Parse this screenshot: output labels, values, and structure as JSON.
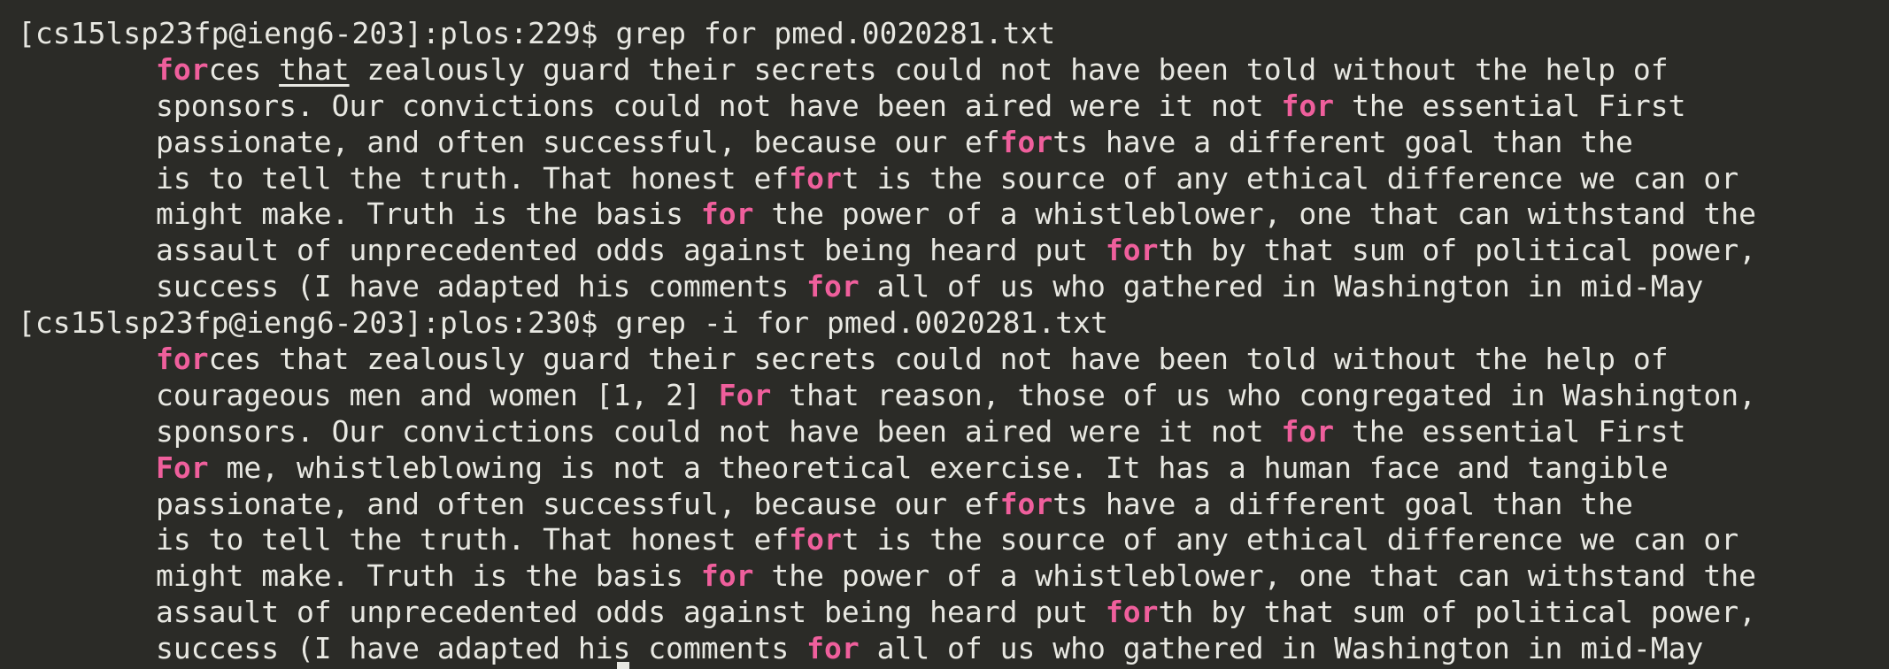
{
  "terminal": {
    "blocks": [
      {
        "prompt": "[cs15lsp23fp@ieng6-203]:plos:229$ ",
        "command": "grep for pmed.0020281.txt",
        "lines": [
          [
            {
              "t": "for",
              "h": true
            },
            {
              "t": "ces "
            },
            {
              "t": "that",
              "u": true
            },
            {
              "t": " zealously guard their secrets could not have been told without the help of"
            }
          ],
          [
            {
              "t": "sponsors. Our convictions could not have been aired were it not "
            },
            {
              "t": "for",
              "h": true
            },
            {
              "t": " the essential First"
            }
          ],
          [
            {
              "t": "passionate, and often successful, because our ef"
            },
            {
              "t": "for",
              "h": true
            },
            {
              "t": "ts have a different goal than the"
            }
          ],
          [
            {
              "t": "is to tell the truth. That honest ef"
            },
            {
              "t": "for",
              "h": true
            },
            {
              "t": "t is the source of any ethical difference we can or"
            }
          ],
          [
            {
              "t": "might make. Truth is the basis "
            },
            {
              "t": "for",
              "h": true
            },
            {
              "t": " the power of a whistleblower, one that can withstand the"
            }
          ],
          [
            {
              "t": "assault of unprecedented odds against being heard put "
            },
            {
              "t": "for",
              "h": true
            },
            {
              "t": "th by that sum of political power,"
            }
          ],
          [
            {
              "t": "success (I have adapted his comments "
            },
            {
              "t": "for",
              "h": true
            },
            {
              "t": " all of us who gathered in Washington in mid-May"
            }
          ]
        ]
      },
      {
        "prompt": "[cs15lsp23fp@ieng6-203]:plos:230$ ",
        "command": "grep -i for pmed.0020281.txt",
        "lines": [
          [
            {
              "t": "for",
              "h": true
            },
            {
              "t": "ces that zealously guard their secrets could not have been told without the help of"
            }
          ],
          [
            {
              "t": "courageous men and women [1, 2] "
            },
            {
              "t": "For",
              "h": true
            },
            {
              "t": " that reason, those of us who congregated in Washington,"
            }
          ],
          [
            {
              "t": "sponsors. Our convictions could not have been aired were it not "
            },
            {
              "t": "for",
              "h": true
            },
            {
              "t": " the essential First"
            }
          ],
          [
            {
              "t": "For",
              "h": true
            },
            {
              "t": " me, whistleblowing is not a theoretical exercise. It has a human face and tangible"
            }
          ],
          [
            {
              "t": "passionate, and often successful, because our ef"
            },
            {
              "t": "for",
              "h": true
            },
            {
              "t": "ts have a different goal than the"
            }
          ],
          [
            {
              "t": "is to tell the truth. That honest ef"
            },
            {
              "t": "for",
              "h": true
            },
            {
              "t": "t is the source of any ethical difference we can or"
            }
          ],
          [
            {
              "t": "might make. Truth is the basis "
            },
            {
              "t": "for",
              "h": true
            },
            {
              "t": " the power of a whistleblower, one that can withstand the"
            }
          ],
          [
            {
              "t": "assault of unprecedented odds against being heard put "
            },
            {
              "t": "for",
              "h": true
            },
            {
              "t": "th by that sum of political power,"
            }
          ],
          [
            {
              "t": "success (I have adapted his comments "
            },
            {
              "t": "for",
              "h": true
            },
            {
              "t": " all of us who gathered in Washington in mid-May"
            }
          ]
        ]
      }
    ]
  },
  "colors": {
    "background": "#2b2b27",
    "text": "#e8e8e2",
    "match_highlight": "#ef5f9c"
  }
}
